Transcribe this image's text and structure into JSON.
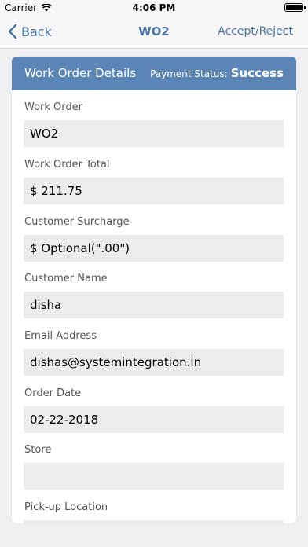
{
  "status_bar": {
    "carrier": "Carrier",
    "time": "4:06 PM"
  },
  "nav": {
    "back_label": "Back",
    "title": "WO2",
    "action_label": "Accept/Reject"
  },
  "card": {
    "title": "Work Order Details",
    "payment_status_label": "Payment Status:",
    "payment_status_value": "Success"
  },
  "fields": {
    "work_order": {
      "label": "Work Order",
      "value": "WO2"
    },
    "work_order_total": {
      "label": "Work Order Total",
      "value": "$ 211.75"
    },
    "customer_surcharge": {
      "label": "Customer Surcharge",
      "value": "$ Optional(\".00\")"
    },
    "customer_name": {
      "label": "Customer Name",
      "value": "disha"
    },
    "email_address": {
      "label": "Email Address",
      "value": "dishas@systemintegration.in"
    },
    "order_date": {
      "label": "Order Date",
      "value": "02-22-2018"
    },
    "store": {
      "label": "Store",
      "value": ""
    },
    "pickup_location": {
      "label": "Pick-up Location",
      "value": ""
    }
  }
}
